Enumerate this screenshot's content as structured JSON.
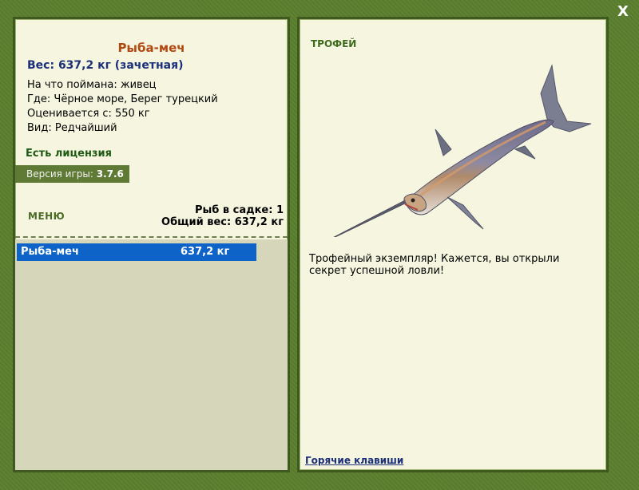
{
  "close_label": "X",
  "fish": {
    "title": "Рыба-меч",
    "weight_line": "Вес: 637,2 кг (зачетная)",
    "caught_with": "На что поймана: живец",
    "where": "Где: Чёрное море, Берег турецкий",
    "valued_from": "Оценивается с: 550 кг",
    "rarity": "Вид: Редчайший"
  },
  "license": "Есть лицензия",
  "version": {
    "label": "Версия игры:",
    "value": "3.7.6"
  },
  "menu_label": "МЕНЮ",
  "stats": {
    "fish_count": "Рыб в садке: 1",
    "total_weight": "Общий вес: 637,2 кг"
  },
  "catch_list": [
    {
      "name": "Рыба-меч",
      "weight": "637,2 кг"
    }
  ],
  "trophy": {
    "label": "ТРОФЕЙ",
    "text": "Трофейный экземпляр! Кажется, вы открыли секрет успешной ловли!"
  },
  "hotkeys_link": "Горячие клавиши",
  "colors": {
    "frame_green": "#5a7a2e",
    "panel_bg": "#f6f6e0",
    "selected_row": "#0d63c7",
    "title_orange": "#b14a12",
    "weight_blue": "#1c2f7a"
  }
}
